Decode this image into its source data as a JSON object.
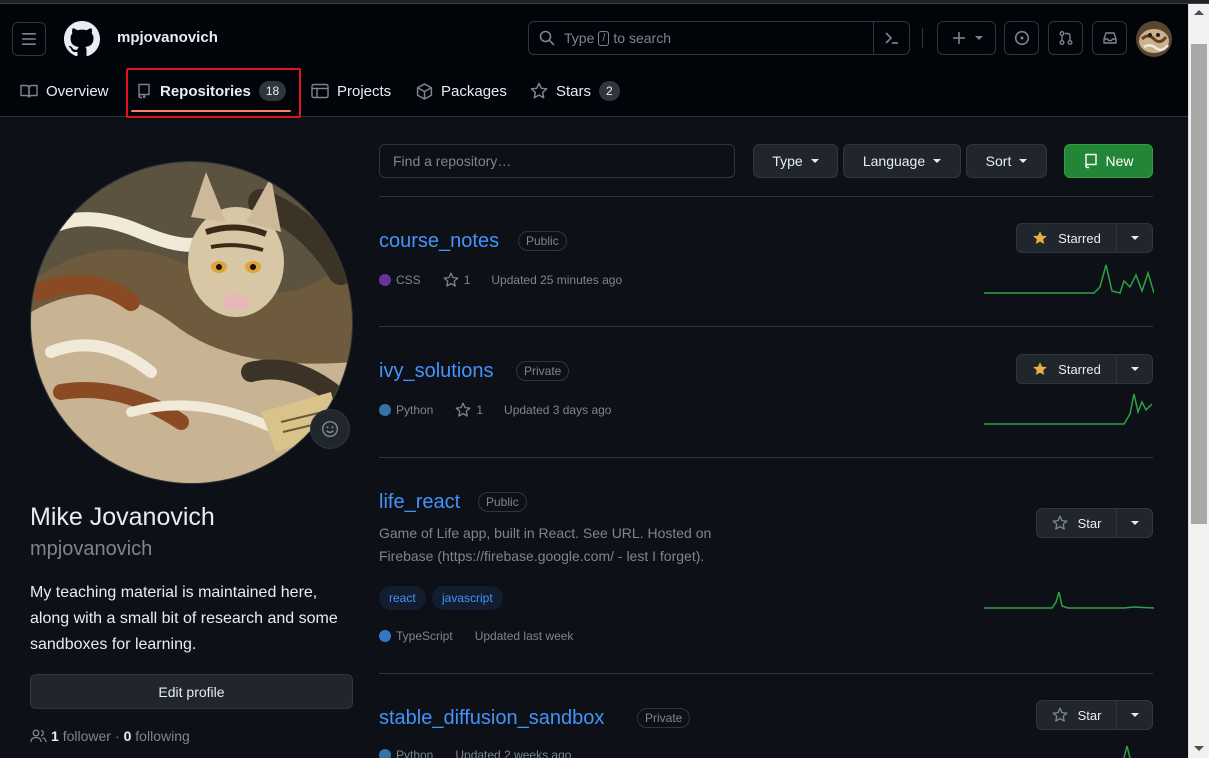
{
  "header": {
    "username": "mpjovanovich",
    "search_placeholder_before": "Type",
    "search_key": "/",
    "search_placeholder_after": "to search"
  },
  "tabs": [
    {
      "label": "Overview"
    },
    {
      "label": "Repositories",
      "count": "18",
      "selected": true
    },
    {
      "label": "Projects"
    },
    {
      "label": "Packages"
    },
    {
      "label": "Stars",
      "count": "2"
    }
  ],
  "profile": {
    "full_name": "Mike Jovanovich",
    "login": "mpjovanovich",
    "bio": "My teaching material is maintained here, along with a small bit of research and some sandboxes for learning.",
    "edit_label": "Edit profile",
    "followers_count": "1",
    "followers_label": "follower",
    "separator": "·",
    "following_count": "0",
    "following_label": "following"
  },
  "repo_toolbar": {
    "find_placeholder": "Find a repository…",
    "type_label": "Type",
    "language_label": "Language",
    "sort_label": "Sort",
    "new_label": "New"
  },
  "repos": [
    {
      "name": "course_notes",
      "visibility": "Public",
      "language": "CSS",
      "language_color": "#663399",
      "stars": "1",
      "updated": "Updated 25 minutes ago",
      "star_label": "Starred",
      "starred": true
    },
    {
      "name": "ivy_solutions",
      "visibility": "Private",
      "language": "Python",
      "language_color": "#3572A5",
      "stars": "1",
      "updated": "Updated 3 days ago",
      "star_label": "Starred",
      "starred": true
    },
    {
      "name": "life_react",
      "visibility": "Public",
      "description_line1": "Game of Life app, built in React. See URL. Hosted on",
      "description_line2": "Firebase (https://firebase.google.com/ - lest I forget).",
      "topics": [
        "react",
        "javascript"
      ],
      "language": "TypeScript",
      "language_color": "#3178c6",
      "updated": "Updated last week",
      "star_label": "Star",
      "starred": false
    },
    {
      "name": "stable_diffusion_sandbox",
      "visibility": "Private",
      "language": "Python",
      "language_color": "#3572A5",
      "updated": "Updated 2 weeks ago",
      "star_label": "Star",
      "starred": false
    }
  ],
  "colors": {
    "accent_link": "#4493f8",
    "new_button": "#238636",
    "tab_underline": "#f78166",
    "annotation": "#e0141e",
    "star_gold": "#e3b341"
  }
}
